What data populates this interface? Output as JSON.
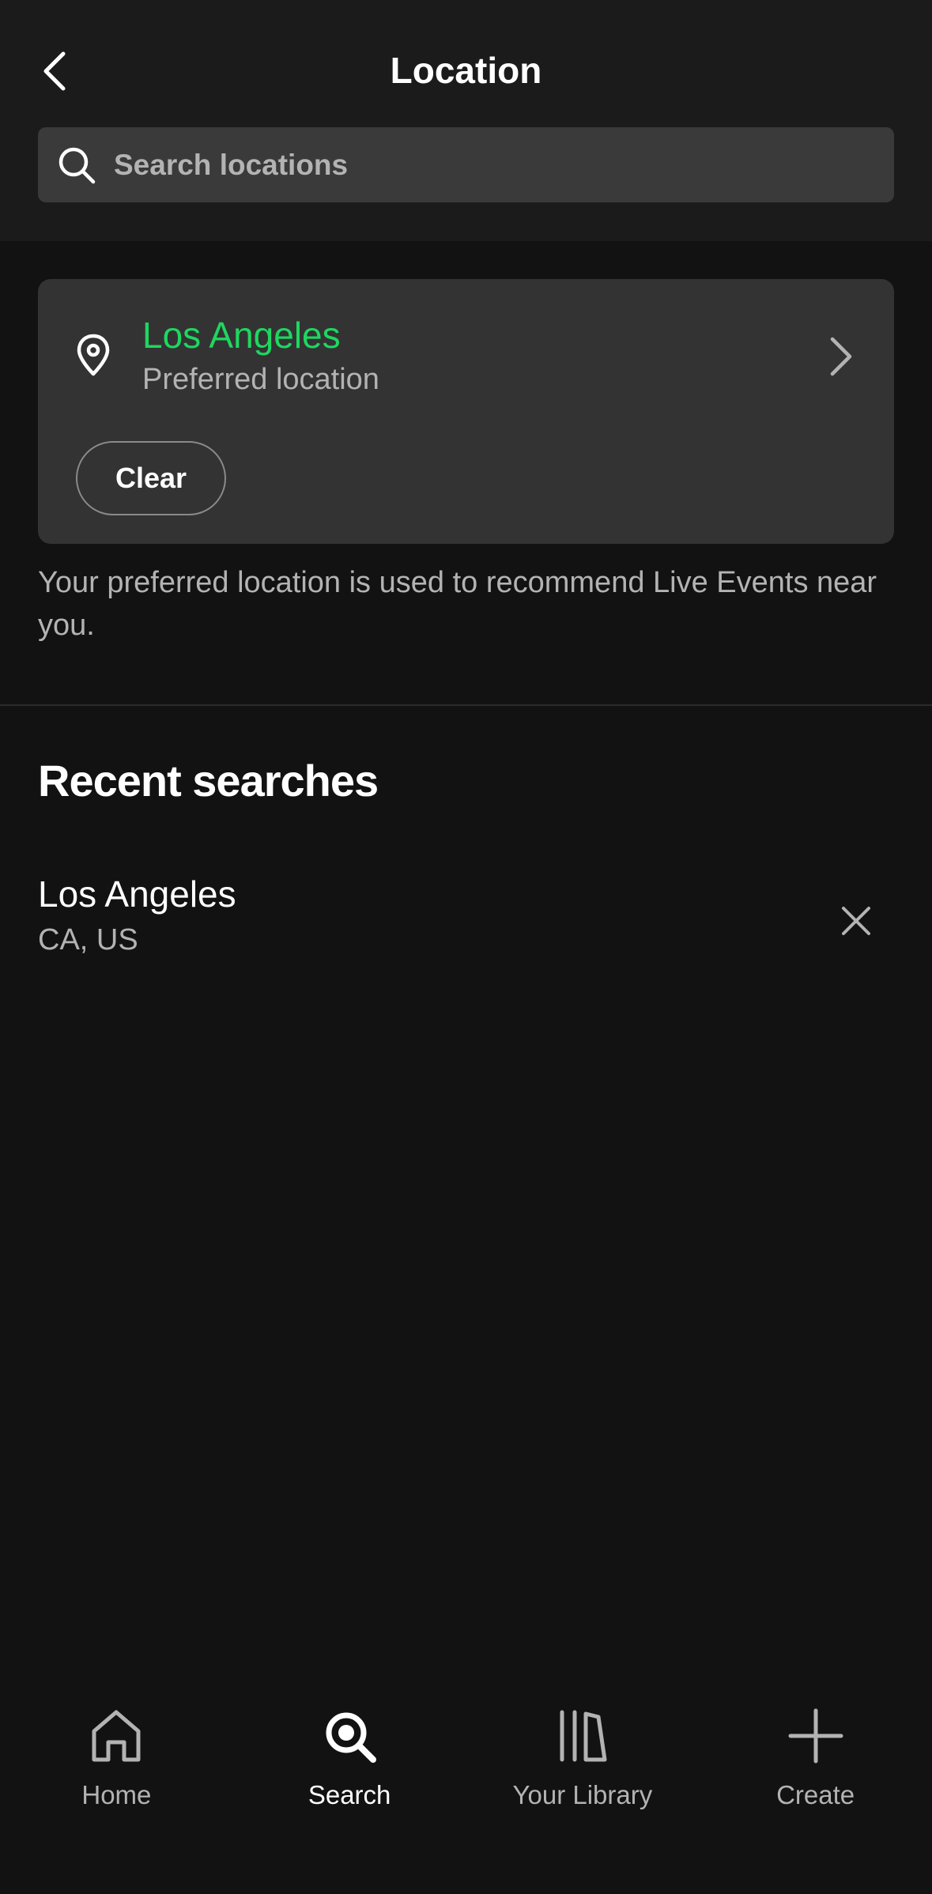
{
  "header": {
    "title": "Location",
    "search": {
      "placeholder": "Search locations",
      "value": ""
    }
  },
  "preferred": {
    "name": "Los Angeles",
    "subtitle": "Preferred location",
    "clear_label": "Clear",
    "accent_color": "#1ed760"
  },
  "info_text": "Your preferred location is used to recommend Live Events near you.",
  "recent": {
    "title": "Recent searches",
    "items": [
      {
        "name": "Los Angeles",
        "subtitle": "CA, US"
      }
    ]
  },
  "nav": {
    "items": [
      {
        "label": "Home",
        "icon": "home-icon",
        "active": false
      },
      {
        "label": "Search",
        "icon": "search-icon",
        "active": true
      },
      {
        "label": "Your Library",
        "icon": "library-icon",
        "active": false
      },
      {
        "label": "Create",
        "icon": "plus-icon",
        "active": false
      }
    ]
  }
}
